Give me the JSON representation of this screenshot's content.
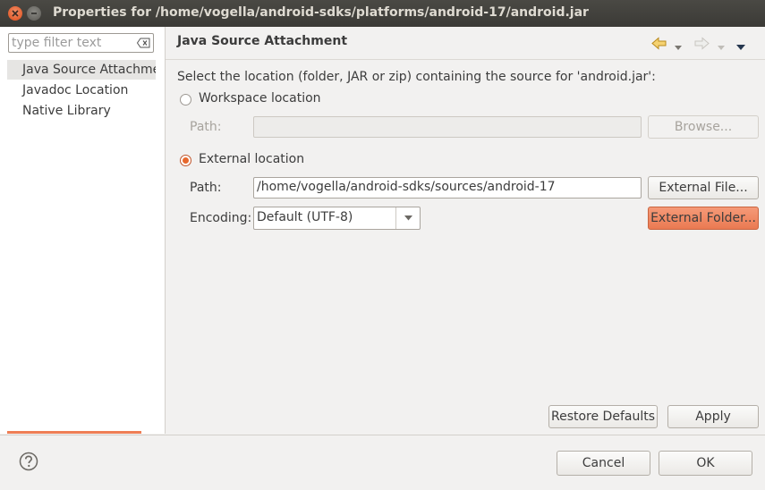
{
  "window": {
    "title": "Properties for /home/vogella/android-sdks/platforms/android-17/android.jar"
  },
  "sidebar": {
    "filter_placeholder": "type filter text",
    "items": [
      {
        "label": "Java Source Attachme",
        "selected": true
      },
      {
        "label": "Javadoc Location",
        "selected": false
      },
      {
        "label": "Native Library",
        "selected": false
      }
    ]
  },
  "page": {
    "title": "Java Source Attachment",
    "description": "Select the location (folder, JAR or zip) containing the source for 'android.jar':",
    "workspace": {
      "radio_label": "Workspace location",
      "selected": false,
      "path_label": "Path:",
      "path_value": "",
      "browse_label": "Browse..."
    },
    "external": {
      "radio_label": "External location",
      "selected": true,
      "path_label": "Path:",
      "path_value": "/home/vogella/android-sdks/sources/android-17",
      "external_file_label": "External File...",
      "encoding_label": "Encoding:",
      "encoding_value": "Default (UTF-8)",
      "external_folder_label": "External Folder..."
    },
    "restore_defaults_label": "Restore Defaults",
    "apply_label": "Apply"
  },
  "footer": {
    "cancel_label": "Cancel",
    "ok_label": "OK"
  },
  "icons": {
    "close": "close-icon",
    "minimize": "minimize-icon",
    "clear_filter": "clear-filter-icon",
    "back": "back-arrow-icon",
    "forward": "forward-arrow-icon",
    "menu": "view-menu-icon",
    "help": "help-icon"
  },
  "colors": {
    "accent": "#e7682d",
    "hot_button": "#ef855e"
  }
}
